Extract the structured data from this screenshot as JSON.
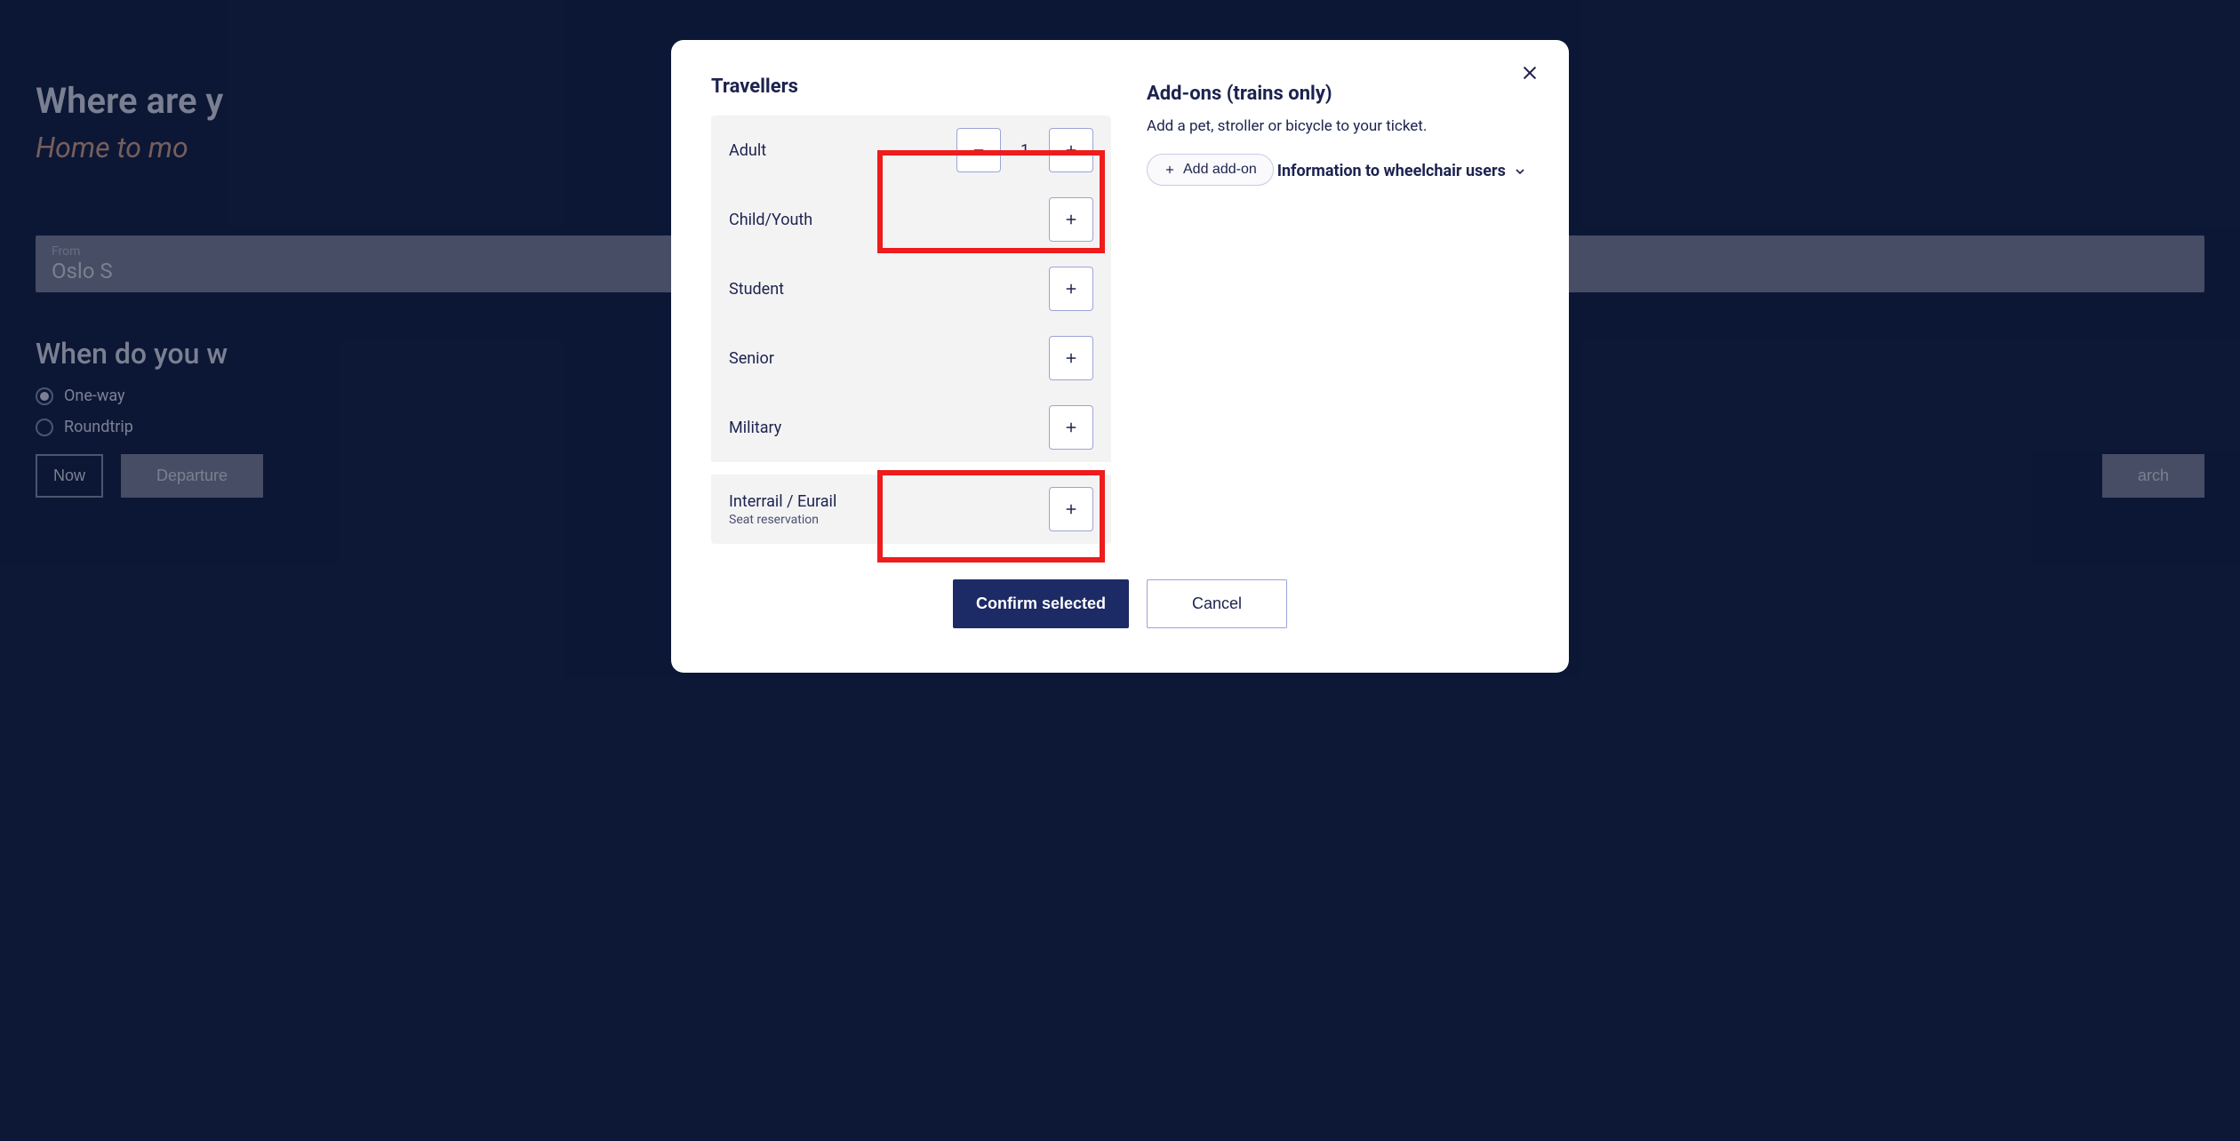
{
  "background": {
    "heading": "Where are y",
    "subtitle": "Home to mo",
    "from_label": "From",
    "from_value": "Oslo S",
    "when_heading": "When do you w",
    "oneway": "One-way",
    "roundtrip": "Roundtrip",
    "now": "Now",
    "departure": "Departure",
    "search": "arch"
  },
  "modal": {
    "travellers_title": "Travellers",
    "rows": [
      {
        "label": "Adult",
        "sub": "",
        "count": "1",
        "show_minus": true
      },
      {
        "label": "Child/Youth",
        "sub": "",
        "count": "",
        "show_minus": false
      },
      {
        "label": "Student",
        "sub": "",
        "count": "",
        "show_minus": false
      },
      {
        "label": "Senior",
        "sub": "",
        "count": "",
        "show_minus": false
      },
      {
        "label": "Military",
        "sub": "",
        "count": "",
        "show_minus": false
      },
      {
        "label": "Interrail / Eurail",
        "sub": "Seat reservation",
        "count": "",
        "show_minus": false
      }
    ],
    "addons_title": "Add-ons (trains only)",
    "addons_desc": "Add a pet, stroller or bicycle to your ticket.",
    "add_addon": "Add add-on",
    "wheelchair_info": "Information to wheelchair users",
    "confirm": "Confirm selected",
    "cancel": "Cancel"
  }
}
